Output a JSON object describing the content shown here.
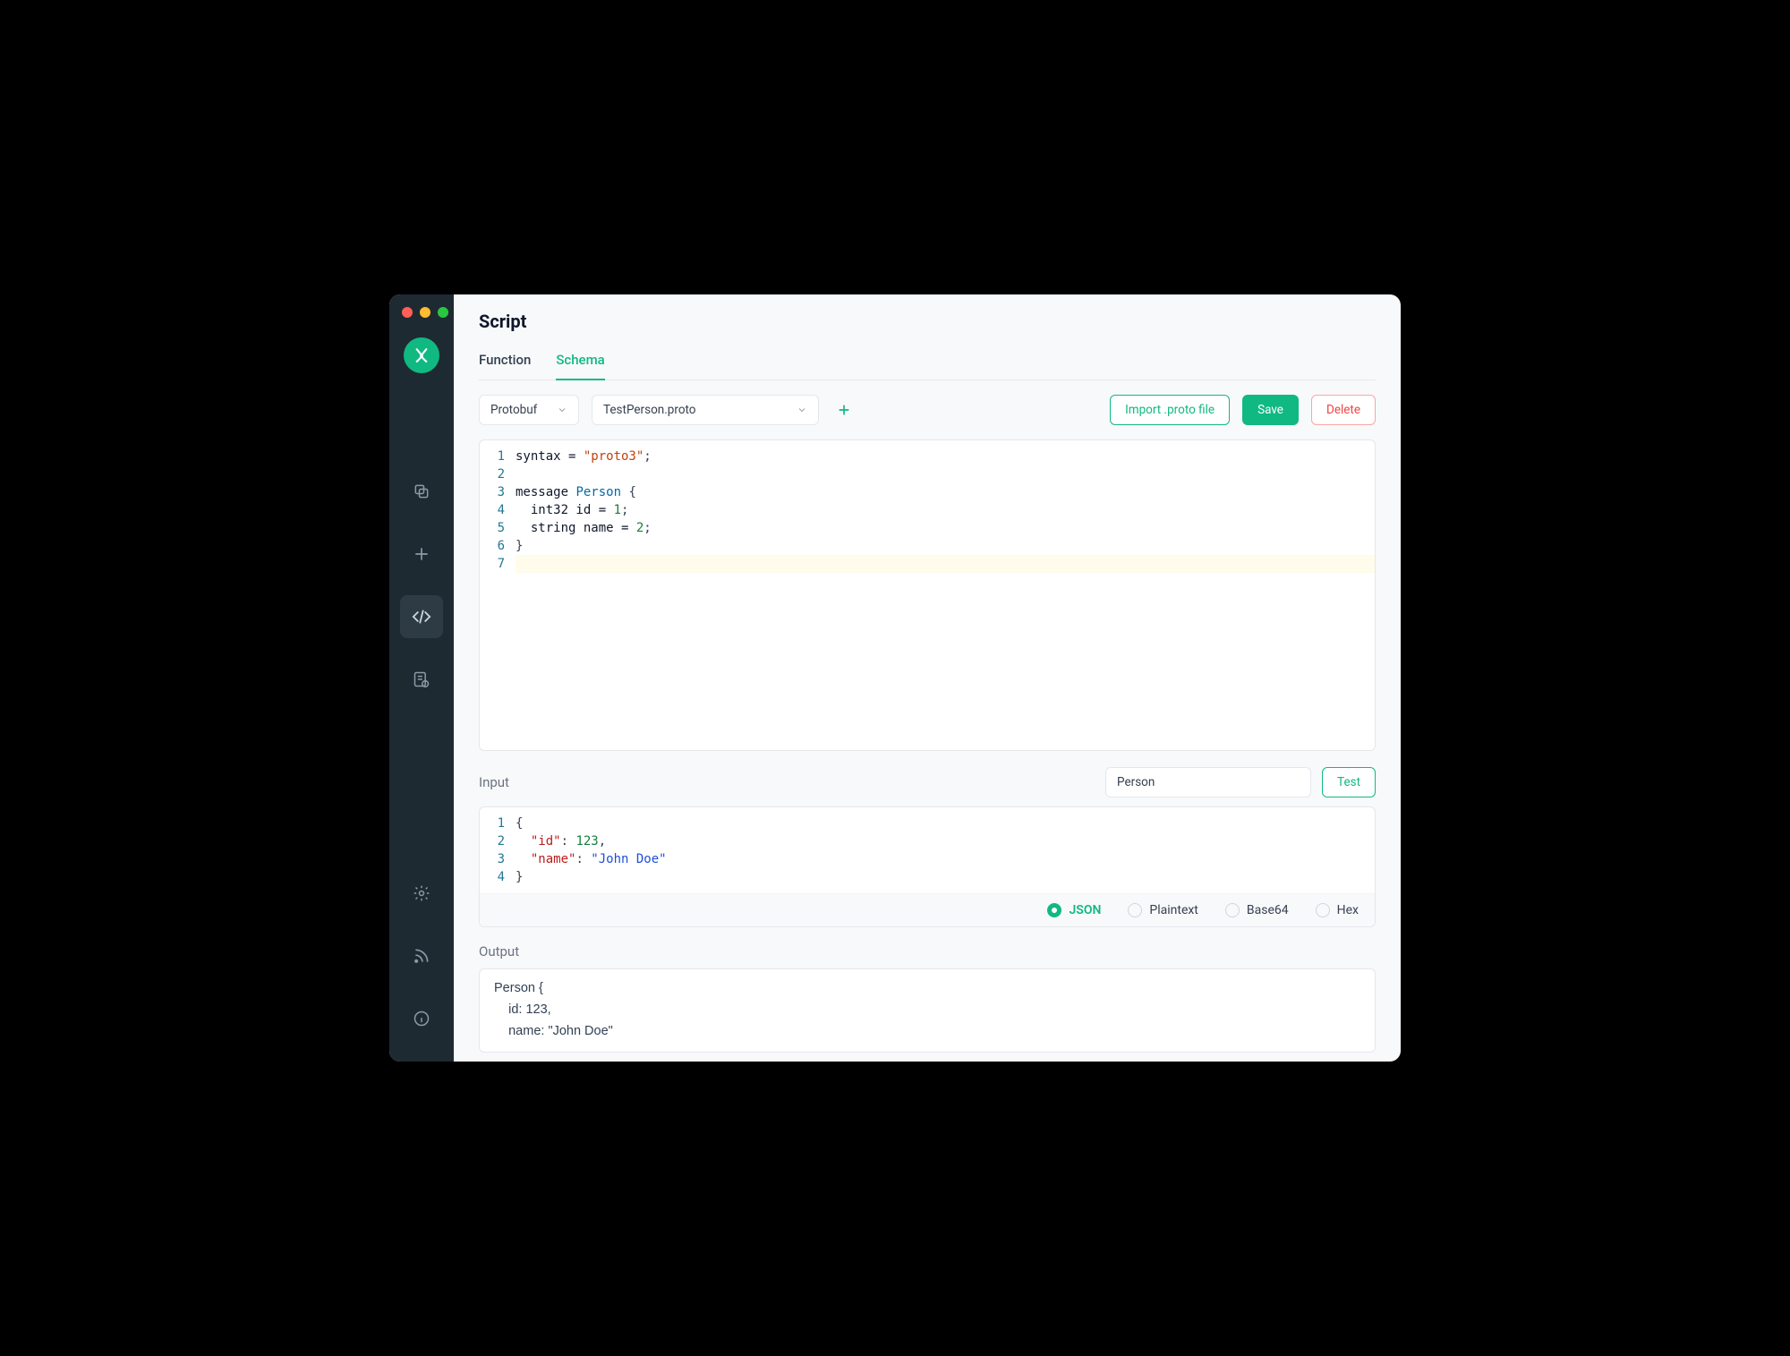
{
  "title": "Script",
  "tabs": [
    "Function",
    "Schema"
  ],
  "active_tab": "Schema",
  "toolbar": {
    "format_select": "Protobuf",
    "file_select": "TestPerson.proto",
    "import_label": "Import .proto file",
    "save_label": "Save",
    "delete_label": "Delete"
  },
  "schema_code": {
    "lines": [
      [
        {
          "t": "syntax = ",
          "c": "kw"
        },
        {
          "t": "\"proto3\"",
          "c": "str"
        },
        {
          "t": ";",
          "c": "punc"
        }
      ],
      [],
      [
        {
          "t": "message ",
          "c": "kw"
        },
        {
          "t": "Person",
          "c": "type"
        },
        {
          "t": " {",
          "c": "punc"
        }
      ],
      [
        {
          "t": "  int32 id = ",
          "c": "kw"
        },
        {
          "t": "1",
          "c": "num"
        },
        {
          "t": ";",
          "c": "punc"
        }
      ],
      [
        {
          "t": "  string name = ",
          "c": "kw"
        },
        {
          "t": "2",
          "c": "num"
        },
        {
          "t": ";",
          "c": "punc"
        }
      ],
      [
        {
          "t": "}",
          "c": "punc"
        }
      ],
      []
    ],
    "highlight_line": 7
  },
  "input": {
    "label": "Input",
    "message_type": "Person",
    "test_label": "Test",
    "code_lines": [
      [
        {
          "t": "{",
          "c": "punc"
        }
      ],
      [
        {
          "t": "  ",
          "c": ""
        },
        {
          "t": "\"id\"",
          "c": "key"
        },
        {
          "t": ": ",
          "c": "punc"
        },
        {
          "t": "123",
          "c": "num"
        },
        {
          "t": ",",
          "c": "punc"
        }
      ],
      [
        {
          "t": "  ",
          "c": ""
        },
        {
          "t": "\"name\"",
          "c": "key"
        },
        {
          "t": ": ",
          "c": "punc"
        },
        {
          "t": "\"John Doe\"",
          "c": "val"
        }
      ],
      [
        {
          "t": "}",
          "c": "punc"
        }
      ]
    ],
    "formats": [
      "JSON",
      "Plaintext",
      "Base64",
      "Hex"
    ],
    "active_format": "JSON"
  },
  "output": {
    "label": "Output",
    "lines": [
      "Person {",
      "    id: 123,",
      "    name: \"John Doe\""
    ]
  }
}
